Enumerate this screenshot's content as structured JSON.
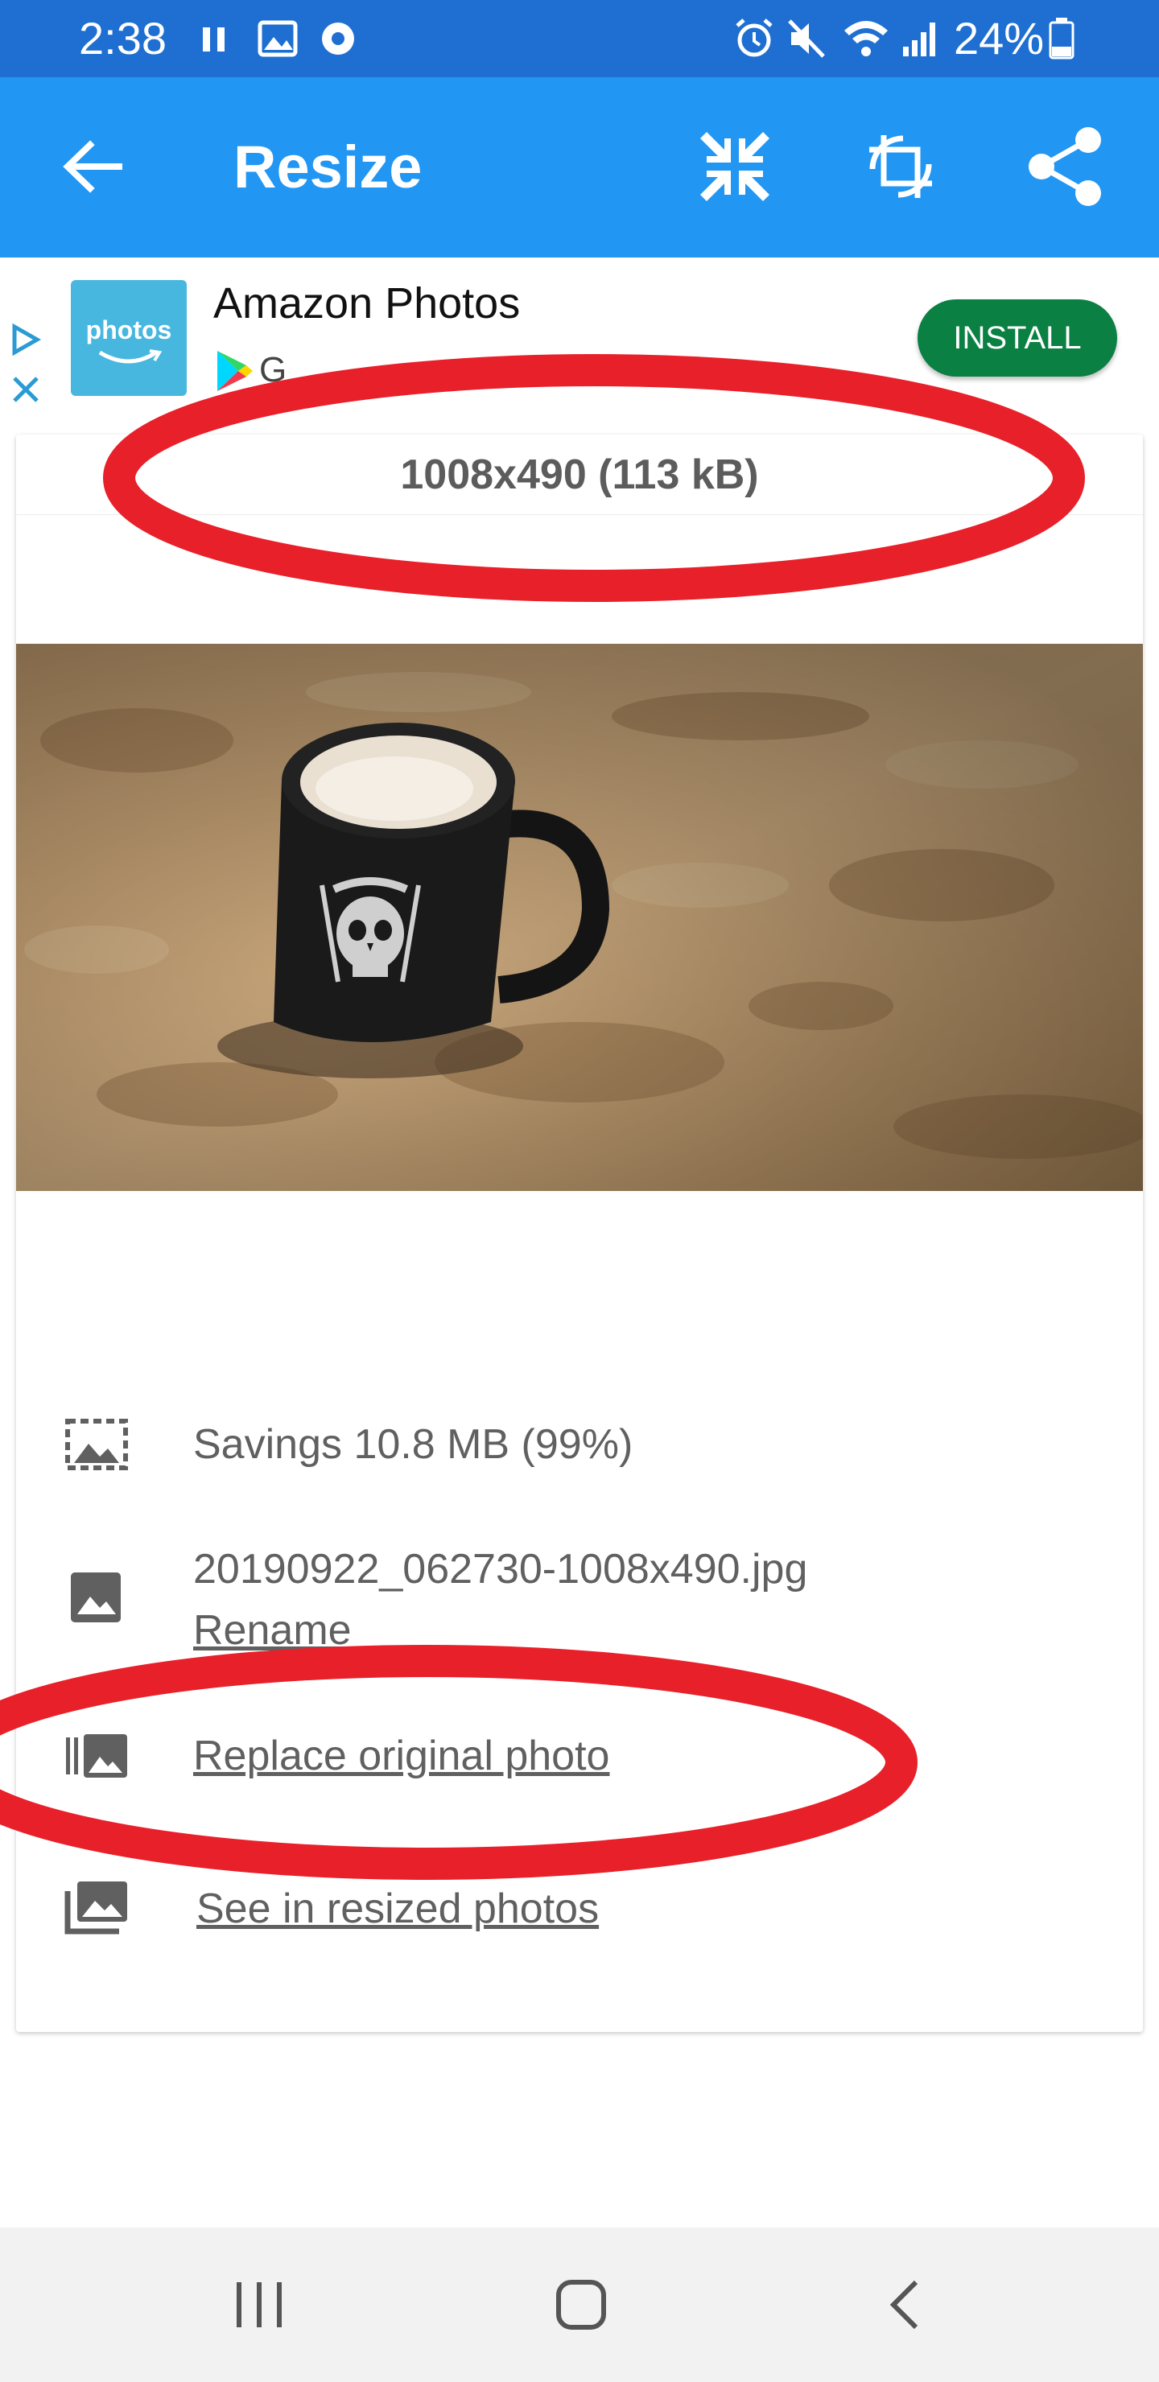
{
  "status_bar": {
    "time": "2:38",
    "battery_percent": "24%",
    "left_icons": [
      "pause-icon",
      "image-icon",
      "camera-notification-icon"
    ],
    "right_icons": [
      "alarm-icon",
      "mute-icon",
      "wifi-icon",
      "signal-icon",
      "battery-icon"
    ]
  },
  "toolbar": {
    "title": "Resize",
    "actions": [
      "compress-icon",
      "crop-icon",
      "share-icon"
    ],
    "background": "#2196f3"
  },
  "ad": {
    "logo_text": "photos",
    "title": "Amazon Photos",
    "subtitle": "G",
    "install_label": "INSTALL",
    "install_color": "#0b8043"
  },
  "result": {
    "dimensions": "1008x490 (113 kB)"
  },
  "details": {
    "savings": "Savings 10.8 MB (99%)",
    "filename": "20190922_062730-1008x490.jpg",
    "rename_label": "Rename",
    "replace_label": "Replace original photo",
    "see_label": "See in resized photos"
  },
  "annotation_color": "#e8202a"
}
